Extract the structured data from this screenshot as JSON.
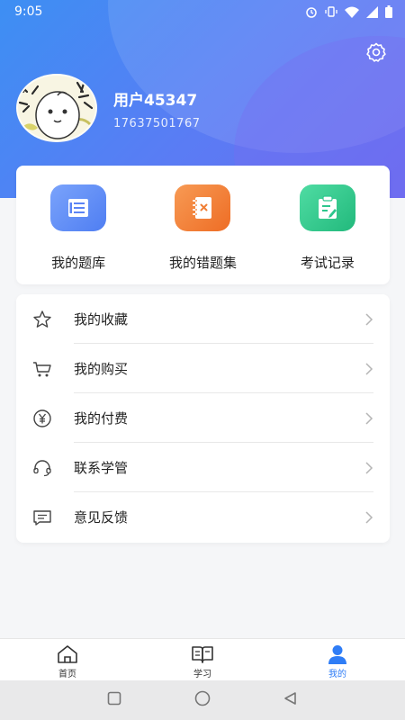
{
  "status_bar": {
    "time": "9:05",
    "icons": [
      "alarm-icon",
      "vibrate-icon",
      "wifi-icon",
      "signal-icon",
      "battery-icon"
    ]
  },
  "profile": {
    "username": "用户45347",
    "phone": "17637501767",
    "settings_icon": "gear-icon"
  },
  "quick_actions": [
    {
      "label": "我的题库",
      "icon": "question-bank-icon",
      "color": "#5b84f5"
    },
    {
      "label": "我的错题集",
      "icon": "wrong-notebook-icon",
      "color": "#f07f35"
    },
    {
      "label": "考试记录",
      "icon": "exam-record-icon",
      "color": "#2dc68d"
    }
  ],
  "menu": [
    {
      "label": "我的收藏",
      "icon": "star-icon"
    },
    {
      "label": "我的购买",
      "icon": "cart-icon"
    },
    {
      "label": "我的付费",
      "icon": "yen-icon"
    },
    {
      "label": "联系学管",
      "icon": "headset-icon"
    },
    {
      "label": "意见反馈",
      "icon": "message-icon"
    }
  ],
  "tabbar": [
    {
      "label": "首页",
      "icon": "home-icon",
      "active": false
    },
    {
      "label": "学习",
      "icon": "book-icon",
      "active": false
    },
    {
      "label": "我的",
      "icon": "user-icon",
      "active": true
    }
  ],
  "colors": {
    "accent": "#2f7df6",
    "header_gradient_start": "#3d8ff3",
    "header_gradient_end": "#6a6cf0"
  }
}
